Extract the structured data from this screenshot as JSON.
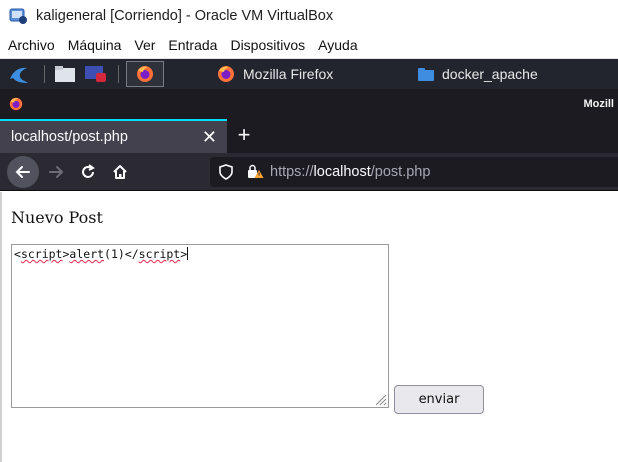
{
  "vbox": {
    "title": "kaligeneral [Corriendo] - Oracle VM VirtualBox",
    "menu": [
      "Archivo",
      "Máquina",
      "Ver",
      "Entrada",
      "Dispositivos",
      "Ayuda"
    ]
  },
  "kali_panel": {
    "taskbar": [
      {
        "label": "Mozilla Firefox",
        "icon": "firefox-icon"
      },
      {
        "label": "docker_apache",
        "icon": "folder-icon"
      }
    ]
  },
  "firefox": {
    "window_title_fragment": "Mozill",
    "tab_label": "localhost/post.php",
    "url": {
      "scheme": "https://",
      "host": "localhost",
      "path": "/post.php"
    }
  },
  "page": {
    "title": "Nuevo Post",
    "textarea_value_tokens": [
      "<",
      "script",
      ">",
      "alert",
      "(1)</",
      "script",
      ">"
    ],
    "send_label": "enviar"
  },
  "colors": {
    "kali_panel": "#23252e",
    "firefox_dark": "#1c1b22",
    "tab_active": "#42414d",
    "accent": "#00ddff"
  }
}
